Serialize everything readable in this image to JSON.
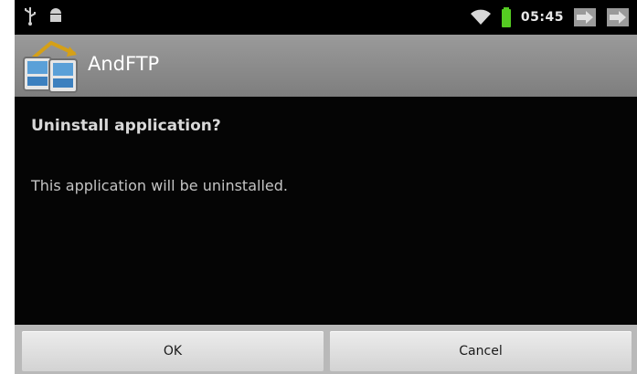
{
  "status_bar": {
    "time": "05:45",
    "icons": [
      "usb-icon",
      "android-debug-icon",
      "wifi-icon",
      "battery-icon",
      "notification-icon",
      "notification-icon"
    ],
    "battery_color": "#55cc22",
    "wifi_color": "#d8d8d8"
  },
  "app": {
    "title": "AndFTP",
    "icon": "andftp-app-icon"
  },
  "dialog": {
    "title": "Uninstall application?",
    "message": "This application will be uninstalled.",
    "ok_label": "OK",
    "cancel_label": "Cancel"
  },
  "colors": {
    "background": "#050505",
    "titlebar": "#8c8c8c",
    "button_bar": "#b9b9b9"
  }
}
